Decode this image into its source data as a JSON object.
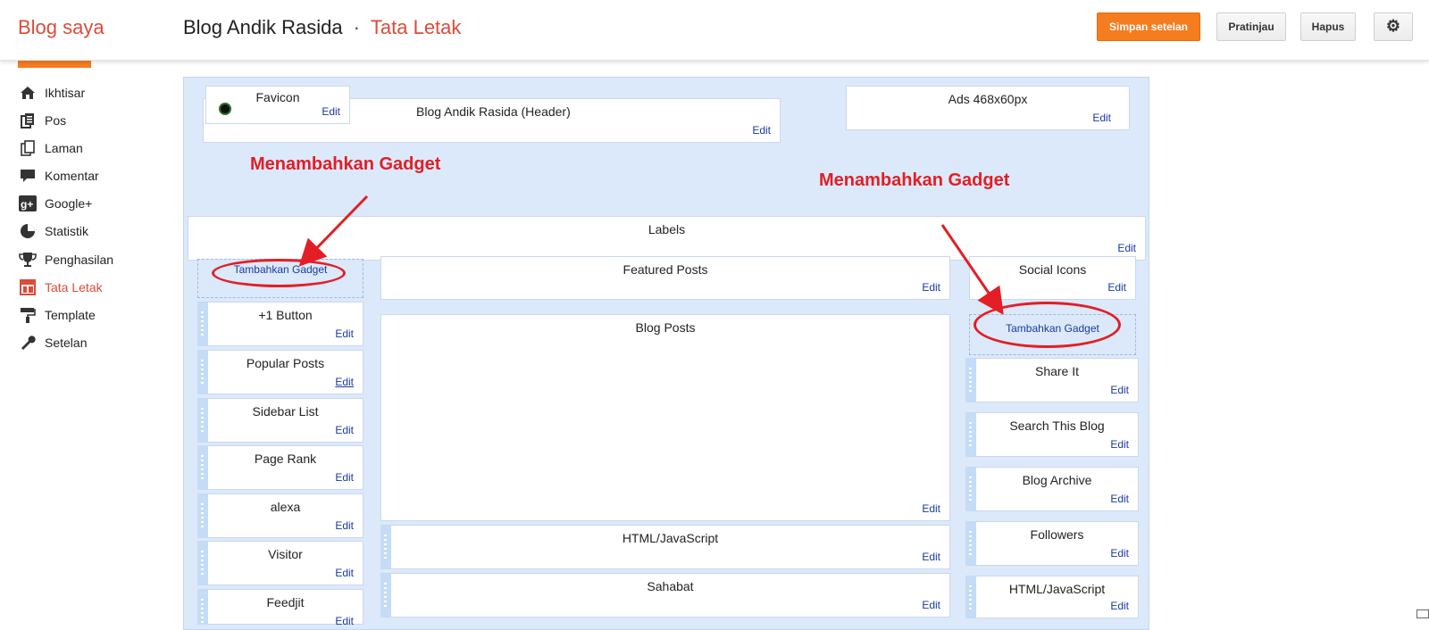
{
  "header": {
    "brand": "Blog saya",
    "blog_name": "Blog Andik Rasida",
    "separator": "·",
    "section": "Tata Letak",
    "buttons": {
      "save": "Simpan setelan",
      "preview": "Pratinjau",
      "delete": "Hapus",
      "settings_icon": "gear-icon"
    }
  },
  "sidebar": {
    "items": [
      {
        "label": "Ikhtisar",
        "icon": "home-icon"
      },
      {
        "label": "Pos",
        "icon": "posts-icon"
      },
      {
        "label": "Laman",
        "icon": "pages-icon"
      },
      {
        "label": "Komentar",
        "icon": "comment-icon"
      },
      {
        "label": "Google+",
        "icon": "google-plus-icon"
      },
      {
        "label": "Statistik",
        "icon": "pie-chart-icon"
      },
      {
        "label": "Penghasilan",
        "icon": "trophy-icon"
      },
      {
        "label": "Tata Letak",
        "icon": "layout-icon",
        "active": true
      },
      {
        "label": "Template",
        "icon": "paint-roller-icon"
      },
      {
        "label": "Setelan",
        "icon": "wrench-icon"
      }
    ]
  },
  "layout": {
    "header_area": {
      "favicon": {
        "title": "Favicon",
        "edit": "Edit"
      },
      "header": {
        "title": "Blog Andik Rasida (Header)",
        "edit": "Edit"
      },
      "ads": {
        "title": "Ads 468x60px",
        "edit": "Edit"
      }
    },
    "labels": {
      "title": "Labels",
      "edit": "Edit"
    },
    "left_sidebar": {
      "add_gadget": "Tambahkan Gadget",
      "gadgets": [
        {
          "title": "+1 Button",
          "edit": "Edit"
        },
        {
          "title": "Popular Posts",
          "edit": "Edit"
        },
        {
          "title": "Sidebar List",
          "edit": "Edit"
        },
        {
          "title": "Page Rank",
          "edit": "Edit"
        },
        {
          "title": "alexa",
          "edit": "Edit"
        },
        {
          "title": "Visitor",
          "edit": "Edit"
        },
        {
          "title": "Feedjit",
          "edit": "Edit"
        }
      ]
    },
    "main": {
      "featured": {
        "title": "Featured Posts",
        "edit": "Edit"
      },
      "blog_posts": {
        "title": "Blog Posts",
        "edit": "Edit"
      },
      "gadgets": [
        {
          "title": "HTML/JavaScript",
          "edit": "Edit"
        },
        {
          "title": "Sahabat",
          "edit": "Edit"
        }
      ]
    },
    "right_sidebar": {
      "social": {
        "title": "Social Icons",
        "edit": "Edit"
      },
      "add_gadget": "Tambahkan Gadget",
      "gadgets": [
        {
          "title": "Share It",
          "edit": "Edit"
        },
        {
          "title": "Search This Blog",
          "edit": "Edit"
        },
        {
          "title": "Blog Archive",
          "edit": "Edit"
        },
        {
          "title": "Followers",
          "edit": "Edit"
        },
        {
          "title": "HTML/JavaScript",
          "edit": "Edit"
        }
      ]
    }
  },
  "annotations": {
    "left": "Menambahkan Gadget",
    "right": "Menambahkan Gadget",
    "color": "#e31e24"
  }
}
